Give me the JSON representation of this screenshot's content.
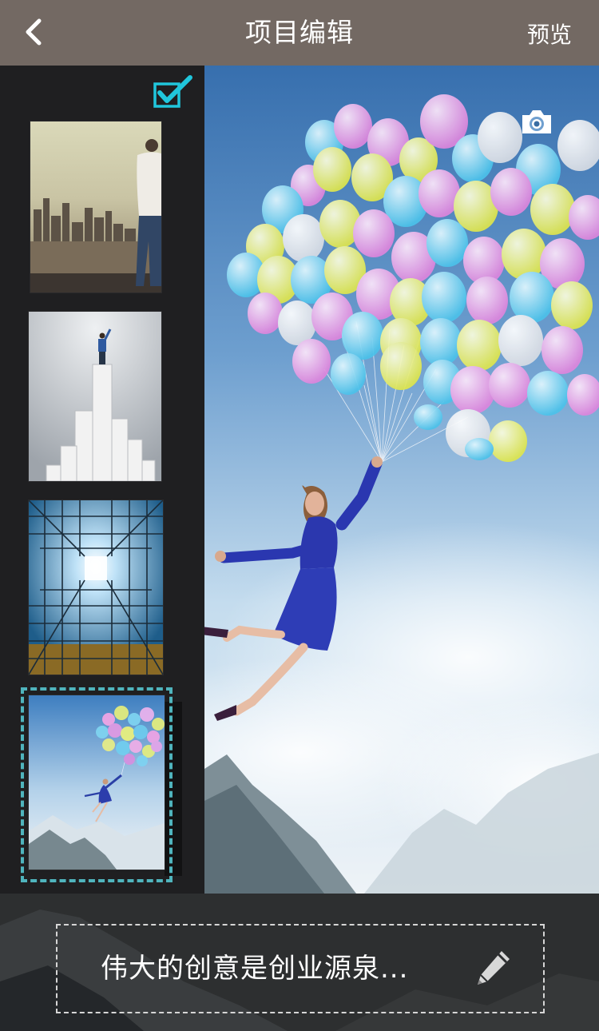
{
  "nav": {
    "back_icon": "chevron-left-icon",
    "title": "项目编辑",
    "preview_label": "预览",
    "background": "#736963"
  },
  "sidebar": {
    "checkbox_icon": "checkbox-checked-icon",
    "accent": "#20c6dc",
    "thumbnails": [
      {
        "name": "man-city-skyline",
        "selected": false
      },
      {
        "name": "man-on-pillar",
        "selected": false
      },
      {
        "name": "glass-building",
        "selected": false
      },
      {
        "name": "balloon-girl",
        "selected": true
      }
    ]
  },
  "canvas": {
    "camera_icon": "camera-icon",
    "image": "balloon-girl"
  },
  "caption": {
    "text": "伟大的创意是创业源泉...",
    "edit_icon": "pencil-icon"
  }
}
